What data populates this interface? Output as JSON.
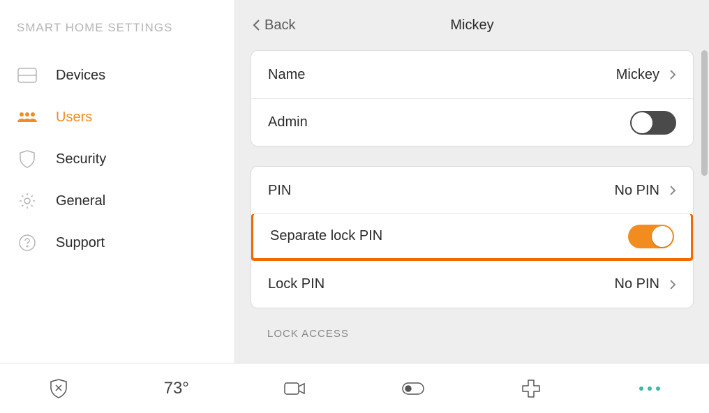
{
  "sidebar": {
    "title": "SMART HOME SETTINGS",
    "items": [
      {
        "label": "Devices"
      },
      {
        "label": "Users"
      },
      {
        "label": "Security"
      },
      {
        "label": "General"
      },
      {
        "label": "Support"
      }
    ],
    "active_index": 1
  },
  "header": {
    "back_label": "Back",
    "title": "Mickey"
  },
  "groups": [
    {
      "rows": [
        {
          "label": "Name",
          "value": "Mickey",
          "kind": "nav"
        },
        {
          "label": "Admin",
          "kind": "toggle",
          "on": false
        }
      ]
    },
    {
      "rows": [
        {
          "label": "PIN",
          "value": "No PIN",
          "kind": "nav"
        },
        {
          "label": "Separate lock PIN",
          "kind": "toggle",
          "on": true,
          "highlight": true
        },
        {
          "label": "Lock PIN",
          "value": "No PIN",
          "kind": "nav"
        }
      ]
    }
  ],
  "section_header": "LOCK ACCESS",
  "bottombar": {
    "temperature": "73°"
  },
  "colors": {
    "accent": "#f28c1f",
    "highlight_border": "#f06a00"
  }
}
